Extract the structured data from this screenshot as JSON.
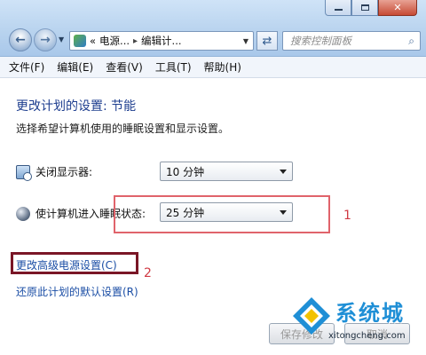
{
  "window": {
    "controls": {
      "minimize": "—",
      "maximize": "□",
      "close": "✕"
    }
  },
  "nav": {
    "address": {
      "prefix": "«",
      "crumb1": "电源...",
      "separator": "▸",
      "crumb2": "编辑计..."
    },
    "search_placeholder": "搜索控制面板"
  },
  "menubar": {
    "items": [
      {
        "label": "文件(F)"
      },
      {
        "label": "编辑(E)"
      },
      {
        "label": "查看(V)"
      },
      {
        "label": "工具(T)"
      },
      {
        "label": "帮助(H)"
      }
    ]
  },
  "content": {
    "title": "更改计划的设置: 节能",
    "description": "选择希望计算机使用的睡眠设置和显示设置。",
    "settings": [
      {
        "label": "关闭显示器:",
        "value": "10 分钟",
        "icon": "display-icon"
      },
      {
        "label": "使计算机进入睡眠状态:",
        "value": "25 分钟",
        "icon": "sleep-icon"
      }
    ],
    "links": {
      "advanced": "更改高级电源设置(C)",
      "restore": "还原此计划的默认设置(R)"
    },
    "buttons": {
      "save": "保存修改",
      "cancel": "取消"
    }
  },
  "annotations": {
    "one": "1",
    "two": "2"
  },
  "watermark": {
    "brand": "系统城",
    "url": "xitongcheng.com"
  },
  "colors": {
    "title": "#1e3e8f",
    "link": "#1b4ea5",
    "annotation": "#e0636b",
    "annotation_dark": "#7a1626"
  }
}
